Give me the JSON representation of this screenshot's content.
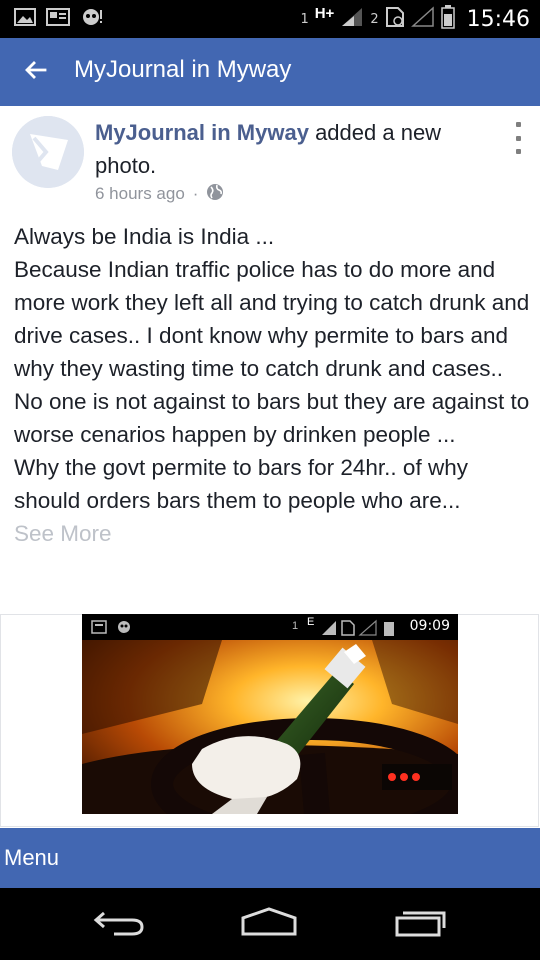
{
  "status_bar": {
    "sim1_label": "1",
    "network_type": "H+",
    "sim2_label": "2",
    "time": "15:46",
    "icons": [
      "gallery-icon",
      "screenshot-icon",
      "mask-icon",
      "signal-icon",
      "no-sim-icon",
      "battery-icon"
    ]
  },
  "app_bar": {
    "title": "MyJournal in Myway",
    "back_icon": "back-arrow-icon"
  },
  "post": {
    "author": "MyJournal in Myway",
    "action": " added a new photo.",
    "time_ago": "6 hours ago",
    "separator": "·",
    "privacy_icon": "globe-icon",
    "lines": [
      "Always be India is India ...",
      "Because Indian traffic police has to do more and more work they left all and trying to catch drunk and drive cases.. I dont know why permite to bars and why they wasting time to catch drunk and cases..",
      "No one is not against to bars but they are against to worse cenarios happen by drinken people ...",
      "Why the govt permite to bars for 24hr.. of why should orders bars them to people who are..."
    ],
    "see_more": "See More"
  },
  "photo": {
    "inner_status": {
      "sim_label": "1",
      "network_type": "E",
      "time": "09:09"
    }
  },
  "menu": {
    "label": "Menu"
  },
  "nav_bar": {
    "icons": [
      "back-icon",
      "home-icon",
      "recents-icon"
    ]
  },
  "colors": {
    "brand": "#4267b2",
    "author": "#4b5f8f",
    "meta": "#90949c",
    "see_more": "#bec2c9"
  }
}
